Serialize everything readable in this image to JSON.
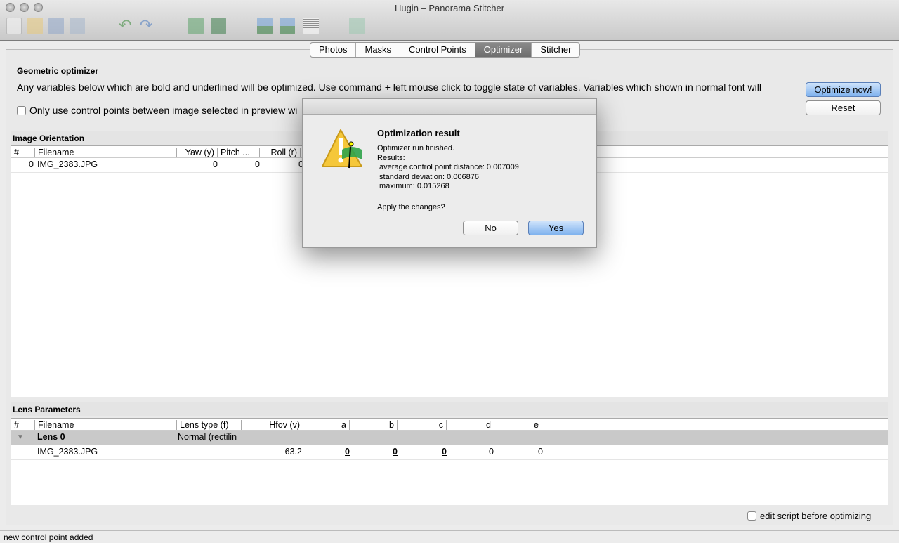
{
  "window": {
    "title": "Hugin – Panorama Stitcher"
  },
  "toolbar": {
    "icons": [
      "new-icon",
      "open-icon",
      "save-icon",
      "save-as-icon",
      "undo-icon",
      "redo-icon",
      "add-images-icon",
      "align-icon",
      "gl-preview-icon",
      "fast-preview-icon",
      "details-icon",
      "stitch-icon"
    ]
  },
  "tabs": [
    {
      "label": "Photos"
    },
    {
      "label": "Masks"
    },
    {
      "label": "Control Points"
    },
    {
      "label": "Optimizer",
      "active": true
    },
    {
      "label": "Stitcher"
    }
  ],
  "optimizer": {
    "heading": "Geometric optimizer",
    "description": "Any variables below which are bold and underlined will be optimized. Use command + left mouse click to toggle state of variables. Variables which shown in normal font will",
    "only_cp_label": "Only use control points between image selected in preview wi",
    "optimize_button": "Optimize now!",
    "reset_button": "Reset"
  },
  "orientation": {
    "title": "Image Orientation",
    "columns": [
      "#",
      "Filename",
      "Yaw (y)",
      "Pitch ...",
      "Roll (r)"
    ],
    "rows": [
      {
        "num": "0",
        "filename": "IMG_2383.JPG",
        "yaw": "0",
        "pitch": "0",
        "roll": "0"
      }
    ]
  },
  "lens": {
    "title": "Lens Parameters",
    "columns": [
      "#",
      "Filename",
      "Lens type (f)",
      "Hfov (v)",
      "a",
      "b",
      "c",
      "d",
      "e"
    ],
    "group": {
      "label": "Lens 0",
      "type": "Normal (rectilin"
    },
    "rows": [
      {
        "filename": "IMG_2383.JPG",
        "hfov": "63.2",
        "a": "0",
        "b": "0",
        "c": "0",
        "d": "0",
        "e": "0"
      }
    ]
  },
  "edit_script_label": "edit script before optimizing",
  "status": "new control point added",
  "dialog": {
    "title": "Optimization result",
    "line1": "Optimizer run finished.",
    "line2": "Results:",
    "avg": " average control point distance: 0.007009",
    "std": " standard deviation: 0.006876",
    "max": " maximum: 0.015268",
    "question": "Apply the changes?",
    "no": "No",
    "yes": "Yes",
    "icon": "warning-icon"
  }
}
